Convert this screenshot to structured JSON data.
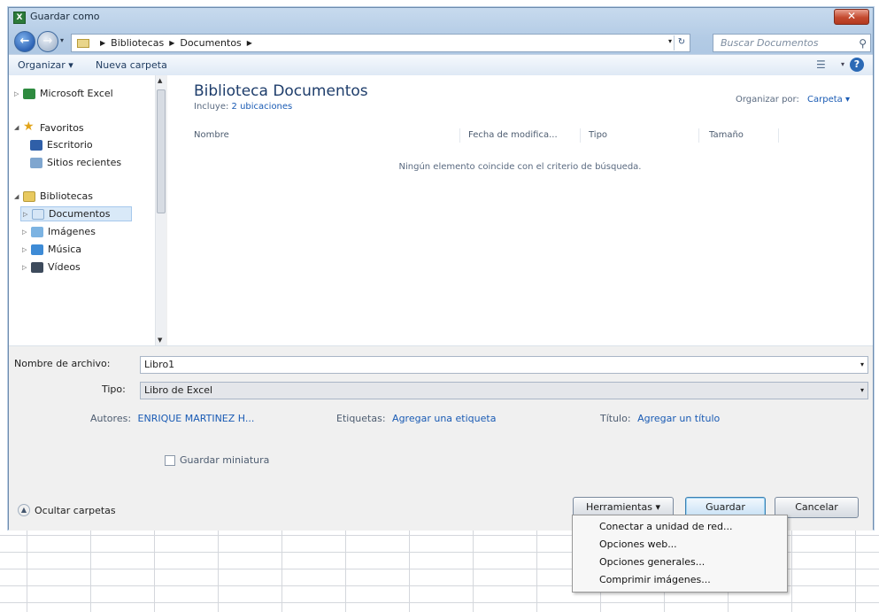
{
  "window": {
    "title": "Guardar como"
  },
  "nav": {
    "breadcrumb": [
      "Bibliotecas",
      "Documentos"
    ],
    "search_placeholder": "Buscar Documentos"
  },
  "toolbar": {
    "organize": "Organizar ▾",
    "new_folder": "Nueva carpeta"
  },
  "sidebar": {
    "items": [
      {
        "label": "Microsoft Excel",
        "icon": "excel-icon"
      },
      {
        "label": "Favoritos",
        "icon": "star-icon"
      },
      {
        "label": "Escritorio",
        "icon": "desktop-icon"
      },
      {
        "label": "Sitios recientes",
        "icon": "recent-places-icon"
      },
      {
        "label": "Bibliotecas",
        "icon": "libraries-icon"
      },
      {
        "label": "Documentos",
        "icon": "documents-icon"
      },
      {
        "label": "Imágenes",
        "icon": "pictures-icon"
      },
      {
        "label": "Música",
        "icon": "music-icon"
      },
      {
        "label": "Vídeos",
        "icon": "videos-icon"
      }
    ]
  },
  "content": {
    "title": "Biblioteca Documentos",
    "includes_label": "Incluye:",
    "includes_link": "2 ubicaciones",
    "organize_by_label": "Organizar por:",
    "organize_by_value": "Carpeta ▾",
    "columns": [
      "Nombre",
      "Fecha de modifica...",
      "Tipo",
      "Tamaño"
    ],
    "empty_message": "Ningún elemento coincide con el criterio de búsqueda."
  },
  "form": {
    "filename_label": "Nombre de archivo:",
    "filename_value": "Libro1",
    "type_label": "Tipo:",
    "type_value": "Libro de Excel",
    "authors_label": "Autores:",
    "authors_value": "ENRIQUE MARTINEZ H...",
    "tags_label": "Etiquetas:",
    "tags_value": "Agregar una etiqueta",
    "title_label": "Título:",
    "title_value": "Agregar un título",
    "thumbnail_label": "Guardar miniatura",
    "hide_folders_label": "Ocultar carpetas"
  },
  "buttons": {
    "tools": "Herramientas  ▾",
    "save": "Guardar",
    "cancel": "Cancelar"
  },
  "tools_menu": {
    "items": [
      "Conectar a unidad de red...",
      "Opciones web...",
      "Opciones generales...",
      "Comprimir imágenes..."
    ]
  },
  "colors": {
    "link": "#1a5bb4",
    "title_blue": "#1e3d6b",
    "close_red": "#c44a2f"
  }
}
